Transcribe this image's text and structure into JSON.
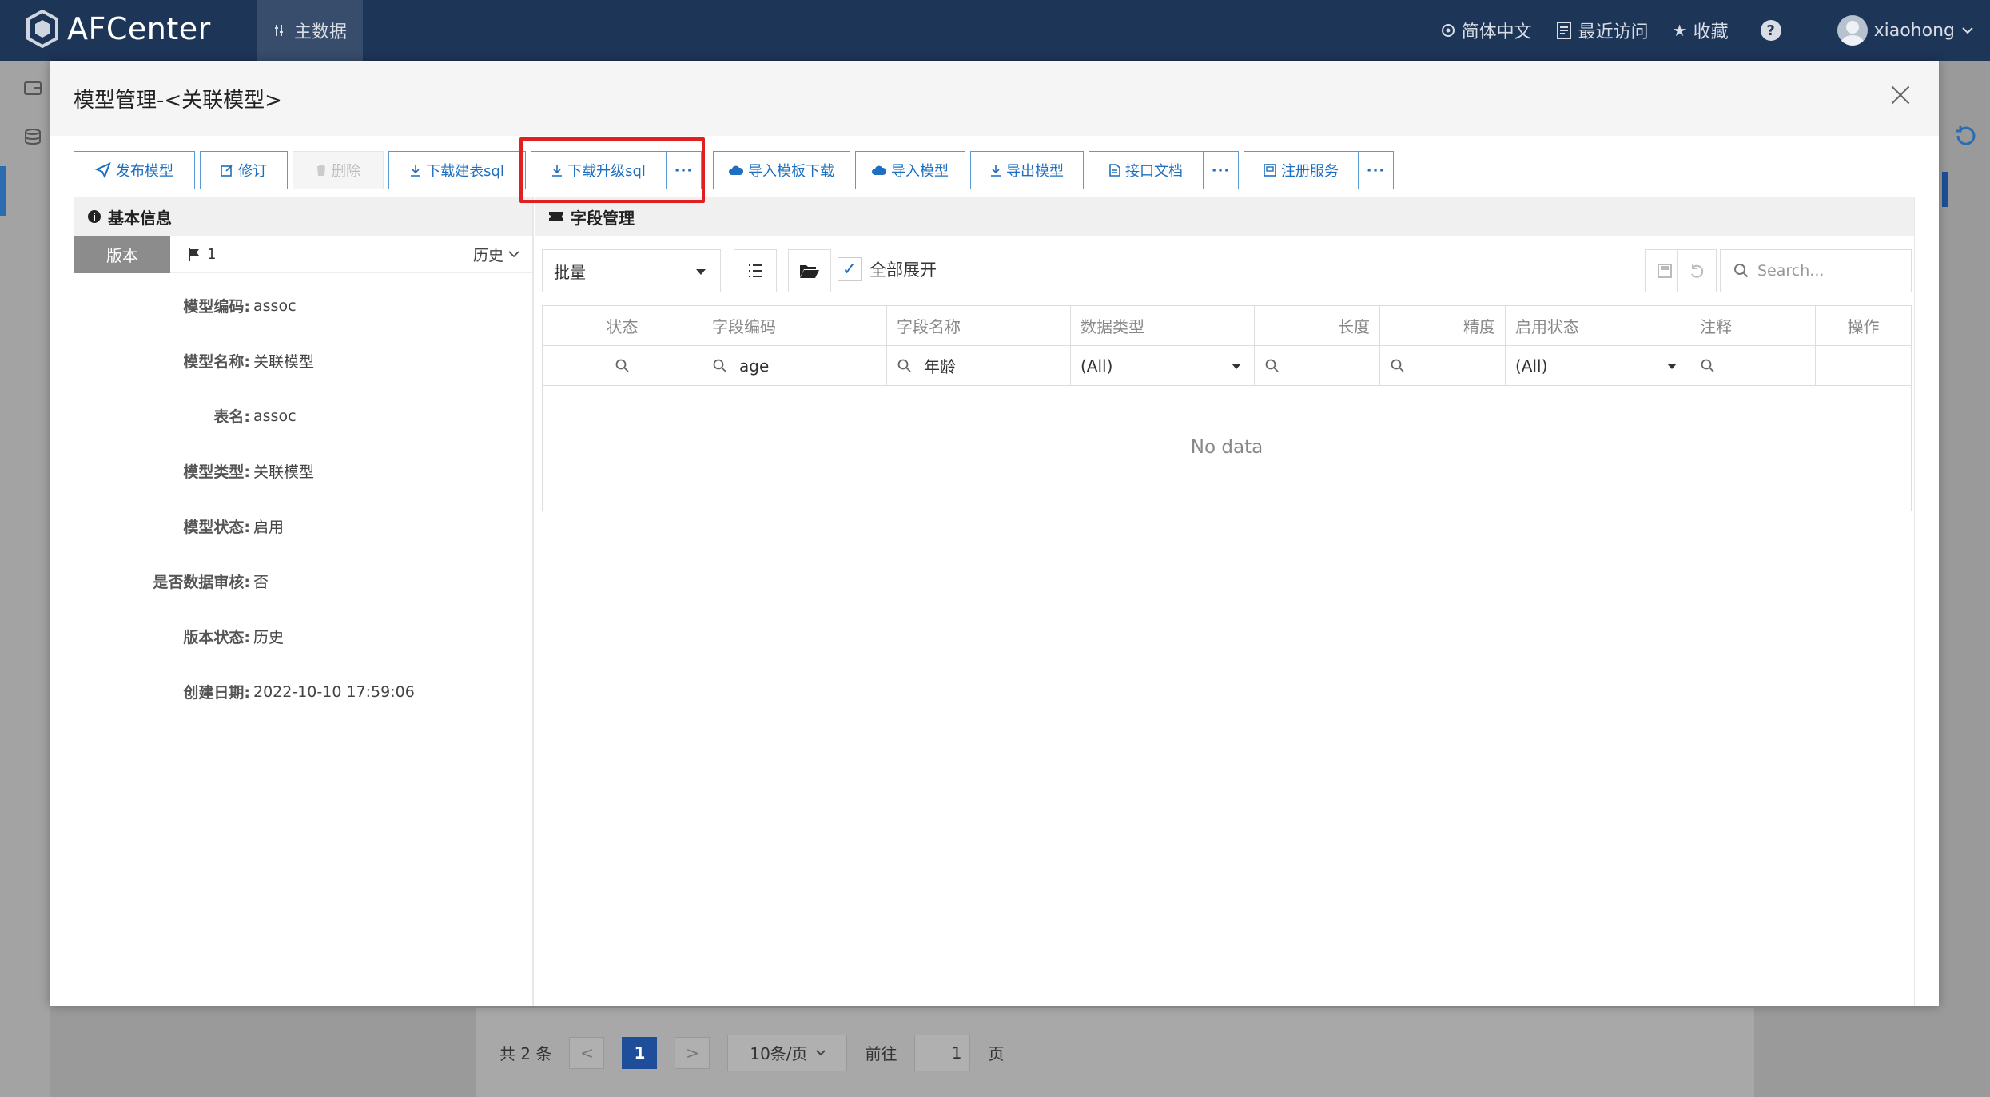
{
  "app": {
    "name": "AFCenter",
    "nav_item": "主数据",
    "lang": "简体中文",
    "recent": "最近访问",
    "favorite": "收藏",
    "help": "?",
    "user": "xiaohong"
  },
  "pager": {
    "total": "共 2 条",
    "prev": "<",
    "current": "1",
    "next": ">",
    "size": "10条/页",
    "goto": "前往",
    "page_value": "1",
    "page_unit": "页"
  },
  "modal": {
    "title": "模型管理-<关联模型>",
    "toolbar": {
      "publish": "发布模型",
      "revise": "修订",
      "delete": "删除",
      "download_create_sql": "下载建表sql",
      "download_upgrade_sql": "下载升级sql",
      "more": "···",
      "import_template": "导入模板下载",
      "import_model": "导入模型",
      "export_model": "导出模型",
      "api_doc": "接口文档",
      "register_service": "注册服务"
    },
    "basic": {
      "section_title": "基本信息",
      "version_tab": "版本",
      "version_no": "1",
      "history": "历史",
      "fields": [
        {
          "label": "模型编码:",
          "value": "assoc"
        },
        {
          "label": "模型名称:",
          "value": "关联模型"
        },
        {
          "label": "表名:",
          "value": "assoc"
        },
        {
          "label": "模型类型:",
          "value": "关联模型"
        },
        {
          "label": "模型状态:",
          "value": "启用"
        },
        {
          "label": "是否数据审核:",
          "value": "否"
        },
        {
          "label": "版本状态:",
          "value": "历史"
        },
        {
          "label": "创建日期:",
          "value": "2022-10-10 17:59:06"
        }
      ]
    },
    "fields_mgmt": {
      "section_title": "字段管理",
      "batch_select": "批量",
      "expand_all": "全部展开",
      "search_placeholder": "Search...",
      "columns": [
        "状态",
        "字段编码",
        "字段名称",
        "数据类型",
        "长度",
        "精度",
        "启用状态",
        "注释",
        "操作"
      ],
      "filters": {
        "code": "age",
        "name": "年龄",
        "data_type": "(All)",
        "enable_status": "(All)"
      },
      "empty_text": "No data"
    }
  },
  "colors": {
    "topbar": "#1d3557",
    "accent": "#1e6fbf",
    "highlight": "#e02020"
  }
}
